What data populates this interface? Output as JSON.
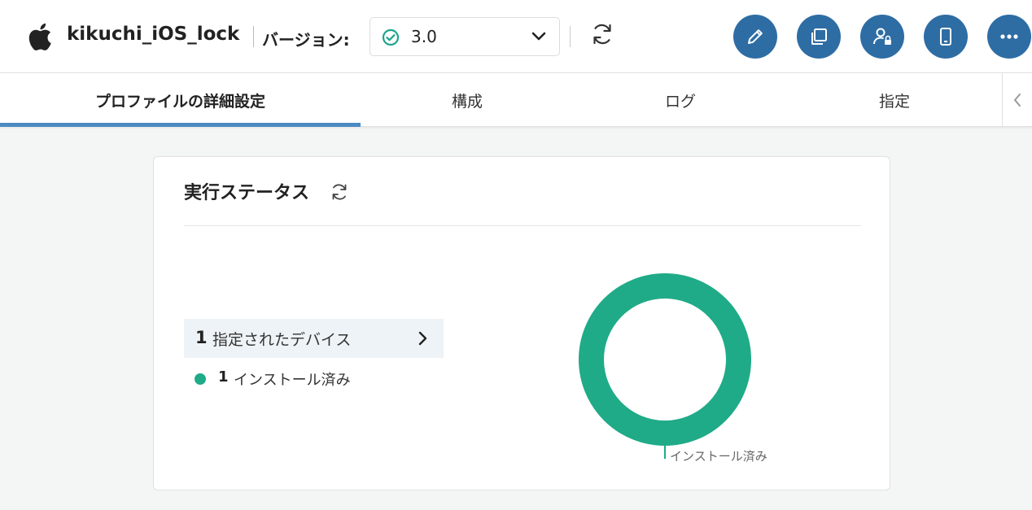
{
  "header": {
    "app_name": "kikuchi_iOS_lock",
    "version_label": "バージョン:",
    "version_value": "3.0",
    "action_buttons": [
      "edit-icon",
      "copy-icon",
      "user-lock-icon",
      "device-icon",
      "more-icon"
    ]
  },
  "tabs": [
    {
      "label": "プロファイルの詳細設定",
      "active": true
    },
    {
      "label": "構成",
      "active": false
    },
    {
      "label": "ログ",
      "active": false
    },
    {
      "label": "指定",
      "active": false
    }
  ],
  "status_card": {
    "title": "実行ステータス",
    "assigned_count": "1",
    "assigned_label": "指定されたデバイス",
    "legend": [
      {
        "count": "1",
        "label": "インストール済み",
        "color": "#1fab87"
      }
    ],
    "donut_label": "インストール済み"
  },
  "colors": {
    "accent": "#2e6da4",
    "tab_underline": "#4a8bc2",
    "installed": "#1fab87",
    "check": "#1aa58c"
  }
}
